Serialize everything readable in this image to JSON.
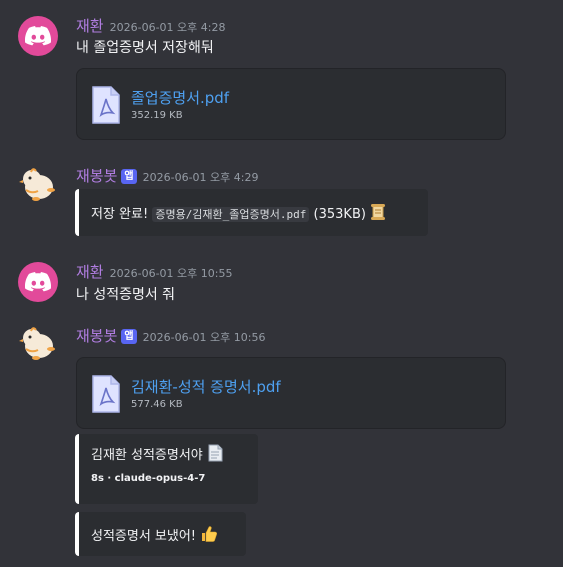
{
  "messages": [
    {
      "author": "재환",
      "timestamp": "2026-06-01 오후 4:28",
      "text": "내 졸업증명서 저장해둬",
      "attachment": {
        "filename": "졸업증명서.pdf",
        "size": "352.19 KB"
      }
    },
    {
      "author": "재봉봇",
      "badge": "앱",
      "timestamp": "2026-06-01 오후 4:29",
      "embed": {
        "prefix": "저장 완료!",
        "path": "증명용/김재환_졸업증명서.pdf",
        "suffix": "(353KB)",
        "emoji": "scroll-icon"
      }
    },
    {
      "author": "재환",
      "timestamp": "2026-06-01 오후 10:55",
      "text": "나 성적증명서 줘"
    },
    {
      "author": "재봉봇",
      "badge": "앱",
      "timestamp": "2026-06-01 오후 10:56",
      "attachment": {
        "filename": "김재환-성적 증명서.pdf",
        "size": "577.46 KB"
      },
      "embed1": {
        "text": "김재환 성적증명서야",
        "emoji": "document-icon",
        "footer": "8s · claude-opus-4-7"
      },
      "embed2": {
        "text": "성적증명서 보냈어!",
        "emoji": "thumbs-up-icon"
      }
    }
  ],
  "colors": {
    "background": "#323339",
    "username": "#b07de0",
    "link": "#4ea0f0",
    "badge": "#5865f2"
  }
}
